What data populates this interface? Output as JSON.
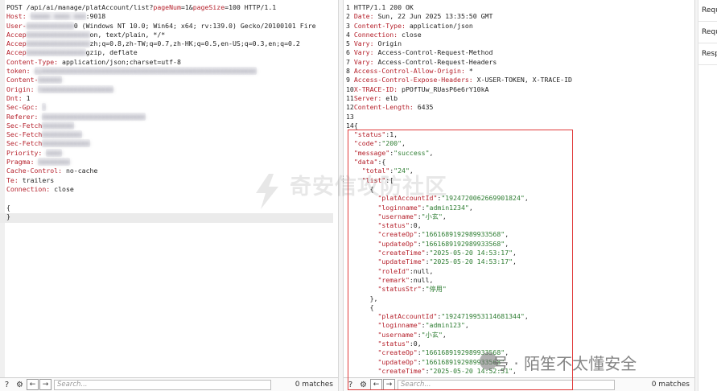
{
  "request": {
    "lines": [
      [
        {
          "t": "POST /api/ai/manage/platAccount/list?",
          "c": "v"
        },
        {
          "t": "pageNum",
          "c": "k"
        },
        {
          "t": "=1&",
          "c": "v"
        },
        {
          "t": "pageSize",
          "c": "k"
        },
        {
          "t": "=100 HTTP/1.1",
          "c": "v"
        }
      ],
      [
        {
          "t": "Host: ",
          "c": "k"
        },
        {
          "t": "hmmmm mmmm mmm",
          "c": "blur"
        },
        {
          "t": ":9018",
          "c": "v"
        }
      ],
      [
        {
          "t": "User-",
          "c": "k"
        },
        {
          "t": "mmmmmmmmmmmm",
          "c": "blur"
        },
        {
          "t": "0 (Windows NT 10.0; Win64; x64; rv:139.0) Gecko/20100101 Fire",
          "c": "v"
        }
      ],
      [
        {
          "t": "Accep",
          "c": "k"
        },
        {
          "t": "mmmmmmmmmmmmmmmm",
          "c": "blur"
        },
        {
          "t": "on, text/plain, */*",
          "c": "v"
        }
      ],
      [
        {
          "t": "Accep",
          "c": "k"
        },
        {
          "t": "mmmmmmmmmmmmmmmm",
          "c": "blur"
        },
        {
          "t": "zh;q=0.8,zh-TW;q=0.7,zh-HK;q=0.5,en-US;q=0.3,en;q=0.2",
          "c": "v"
        }
      ],
      [
        {
          "t": "Accep",
          "c": "k"
        },
        {
          "t": "mmmmmmmmmmmmmmm",
          "c": "blur"
        },
        {
          "t": "gzip, deflate",
          "c": "v"
        }
      ],
      [
        {
          "t": "Content-Type: ",
          "c": "k"
        },
        {
          "t": "application/json;charset=utf-8",
          "c": "v"
        }
      ],
      [
        {
          "t": "token: ",
          "c": "k"
        },
        {
          "t": "eymmmmmmmmmmmmmmmmmmmmmmmmmmmmmmmmmmmmmmmmmmmmmmmmmmmmmm",
          "c": "blur"
        }
      ],
      [
        {
          "t": "Content-",
          "c": "k"
        },
        {
          "t": "mmmmmm",
          "c": "blur"
        }
      ],
      [
        {
          "t": "Origin: ",
          "c": "k"
        },
        {
          "t": "hmmmmmmmmmmmmmmmmmm",
          "c": "blur"
        }
      ],
      [
        {
          "t": "Dnt: ",
          "c": "k"
        },
        {
          "t": "1",
          "c": "v"
        }
      ],
      [
        {
          "t": "Sec-Gpc: ",
          "c": "k"
        },
        {
          "t": "1",
          "c": "blur"
        }
      ],
      [
        {
          "t": "Referer: ",
          "c": "k"
        },
        {
          "t": "mmmmmmmmmmmmmmmmmmmmmmmmmm",
          "c": "blur"
        }
      ],
      [
        {
          "t": "Sec-Fetch",
          "c": "k"
        },
        {
          "t": "mmmmmmmm",
          "c": "blur"
        }
      ],
      [
        {
          "t": "Sec-Fetch",
          "c": "k"
        },
        {
          "t": "mmmmmmmmmm",
          "c": "blur"
        }
      ],
      [
        {
          "t": "Sec-Fetch",
          "c": "k"
        },
        {
          "t": "mmmmmmmmmmmm",
          "c": "blur"
        }
      ],
      [
        {
          "t": "Priority: ",
          "c": "k"
        },
        {
          "t": "mmmm",
          "c": "blur"
        }
      ],
      [
        {
          "t": "Pragma: ",
          "c": "k"
        },
        {
          "t": "mmmmmmmm",
          "c": "blur"
        }
      ],
      [
        {
          "t": "Cache-Control: ",
          "c": "k"
        },
        {
          "t": "no-cache",
          "c": "v"
        }
      ],
      [
        {
          "t": "Te: ",
          "c": "k"
        },
        {
          "t": "trailers",
          "c": "v"
        }
      ],
      [
        {
          "t": "Connection: ",
          "c": "k"
        },
        {
          "t": "close",
          "c": "v"
        }
      ],
      [
        {
          "t": "",
          "c": "v"
        }
      ],
      [
        {
          "t": "{",
          "c": "v"
        }
      ],
      [
        {
          "t": "}",
          "c": "v"
        }
      ]
    ],
    "search_placeholder": "Search...",
    "matches": "0 matches"
  },
  "response": {
    "lines": [
      [
        {
          "t": "1 ",
          "c": "v"
        },
        {
          "t": "HTTP/1.1 200 OK",
          "c": "v"
        }
      ],
      [
        {
          "t": "2 ",
          "c": "v"
        },
        {
          "t": "Date: ",
          "c": "k"
        },
        {
          "t": "Sun, 22 Jun 2025 13:35:50 GMT",
          "c": "v"
        }
      ],
      [
        {
          "t": "3 ",
          "c": "v"
        },
        {
          "t": "Content-Type: ",
          "c": "k"
        },
        {
          "t": "application/json",
          "c": "v"
        }
      ],
      [
        {
          "t": "4 ",
          "c": "v"
        },
        {
          "t": "Connection: ",
          "c": "k"
        },
        {
          "t": "close",
          "c": "v"
        }
      ],
      [
        {
          "t": "5 ",
          "c": "v"
        },
        {
          "t": "Vary: ",
          "c": "k"
        },
        {
          "t": "Origin",
          "c": "v"
        }
      ],
      [
        {
          "t": "6 ",
          "c": "v"
        },
        {
          "t": "Vary: ",
          "c": "k"
        },
        {
          "t": "Access-Control-Request-Method",
          "c": "v"
        }
      ],
      [
        {
          "t": "7 ",
          "c": "v"
        },
        {
          "t": "Vary: ",
          "c": "k"
        },
        {
          "t": "Access-Control-Request-Headers",
          "c": "v"
        }
      ],
      [
        {
          "t": "8 ",
          "c": "v"
        },
        {
          "t": "Access-Control-Allow-Origin: ",
          "c": "k"
        },
        {
          "t": "*",
          "c": "v"
        }
      ],
      [
        {
          "t": "9 ",
          "c": "v"
        },
        {
          "t": "Access-Control-Expose-Headers: ",
          "c": "k"
        },
        {
          "t": "X-USER-TOKEN, X-TRACE-ID",
          "c": "v"
        }
      ],
      [
        {
          "t": "10",
          "c": "v"
        },
        {
          "t": "X-TRACE-ID: ",
          "c": "k"
        },
        {
          "t": "pPOfTUw_RUasP6e6rY10kA",
          "c": "v"
        }
      ],
      [
        {
          "t": "11",
          "c": "v"
        },
        {
          "t": "Server: ",
          "c": "k"
        },
        {
          "t": "elb",
          "c": "v"
        }
      ],
      [
        {
          "t": "12",
          "c": "v"
        },
        {
          "t": "Content-Length: ",
          "c": "k"
        },
        {
          "t": "6435",
          "c": "v"
        }
      ],
      [
        {
          "t": "13",
          "c": "v"
        }
      ],
      [
        {
          "t": "14",
          "c": "v"
        },
        {
          "t": "{",
          "c": "v"
        }
      ],
      [
        {
          "t": "  ",
          "c": "v"
        },
        {
          "t": "\"status\"",
          "c": "k"
        },
        {
          "t": ":1,",
          "c": "n"
        }
      ],
      [
        {
          "t": "  ",
          "c": "v"
        },
        {
          "t": "\"code\"",
          "c": "k"
        },
        {
          "t": ":",
          "c": "n"
        },
        {
          "t": "\"200\"",
          "c": "s"
        },
        {
          "t": ",",
          "c": "n"
        }
      ],
      [
        {
          "t": "  ",
          "c": "v"
        },
        {
          "t": "\"message\"",
          "c": "k"
        },
        {
          "t": ":",
          "c": "n"
        },
        {
          "t": "\"success\"",
          "c": "s"
        },
        {
          "t": ",",
          "c": "n"
        }
      ],
      [
        {
          "t": "  ",
          "c": "v"
        },
        {
          "t": "\"data\"",
          "c": "k"
        },
        {
          "t": ":{",
          "c": "n"
        }
      ],
      [
        {
          "t": "    ",
          "c": "v"
        },
        {
          "t": "\"total\"",
          "c": "k"
        },
        {
          "t": ":",
          "c": "n"
        },
        {
          "t": "\"24\"",
          "c": "s"
        },
        {
          "t": ",",
          "c": "n"
        }
      ],
      [
        {
          "t": "    ",
          "c": "v"
        },
        {
          "t": "\"list\"",
          "c": "k"
        },
        {
          "t": ":[",
          "c": "n"
        }
      ],
      [
        {
          "t": "      ",
          "c": "v"
        },
        {
          "t": "{",
          "c": "n"
        }
      ],
      [
        {
          "t": "        ",
          "c": "v"
        },
        {
          "t": "\"platAccountId\"",
          "c": "k"
        },
        {
          "t": ":",
          "c": "n"
        },
        {
          "t": "\"1924720062669901824\"",
          "c": "s"
        },
        {
          "t": ",",
          "c": "n"
        }
      ],
      [
        {
          "t": "        ",
          "c": "v"
        },
        {
          "t": "\"loginname\"",
          "c": "k"
        },
        {
          "t": ":",
          "c": "n"
        },
        {
          "t": "\"admin1234\"",
          "c": "s"
        },
        {
          "t": ",",
          "c": "n"
        }
      ],
      [
        {
          "t": "        ",
          "c": "v"
        },
        {
          "t": "\"username\"",
          "c": "k"
        },
        {
          "t": ":",
          "c": "n"
        },
        {
          "t": "\"小玄\"",
          "c": "s"
        },
        {
          "t": ",",
          "c": "n"
        }
      ],
      [
        {
          "t": "        ",
          "c": "v"
        },
        {
          "t": "\"status\"",
          "c": "k"
        },
        {
          "t": ":0,",
          "c": "n"
        }
      ],
      [
        {
          "t": "        ",
          "c": "v"
        },
        {
          "t": "\"createOp\"",
          "c": "k"
        },
        {
          "t": ":",
          "c": "n"
        },
        {
          "t": "\"1661689192989933568\"",
          "c": "s"
        },
        {
          "t": ",",
          "c": "n"
        }
      ],
      [
        {
          "t": "        ",
          "c": "v"
        },
        {
          "t": "\"updateOp\"",
          "c": "k"
        },
        {
          "t": ":",
          "c": "n"
        },
        {
          "t": "\"1661689192989933568\"",
          "c": "s"
        },
        {
          "t": ",",
          "c": "n"
        }
      ],
      [
        {
          "t": "        ",
          "c": "v"
        },
        {
          "t": "\"createTime\"",
          "c": "k"
        },
        {
          "t": ":",
          "c": "n"
        },
        {
          "t": "\"2025-05-20 14:53:17\"",
          "c": "s"
        },
        {
          "t": ",",
          "c": "n"
        }
      ],
      [
        {
          "t": "        ",
          "c": "v"
        },
        {
          "t": "\"updateTime\"",
          "c": "k"
        },
        {
          "t": ":",
          "c": "n"
        },
        {
          "t": "\"2025-05-20 14:53:17\"",
          "c": "s"
        },
        {
          "t": ",",
          "c": "n"
        }
      ],
      [
        {
          "t": "        ",
          "c": "v"
        },
        {
          "t": "\"roleId\"",
          "c": "k"
        },
        {
          "t": ":null,",
          "c": "n"
        }
      ],
      [
        {
          "t": "        ",
          "c": "v"
        },
        {
          "t": "\"remark\"",
          "c": "k"
        },
        {
          "t": ":null,",
          "c": "n"
        }
      ],
      [
        {
          "t": "        ",
          "c": "v"
        },
        {
          "t": "\"statusStr\"",
          "c": "k"
        },
        {
          "t": ":",
          "c": "n"
        },
        {
          "t": "\"停用\"",
          "c": "s"
        }
      ],
      [
        {
          "t": "      ",
          "c": "v"
        },
        {
          "t": "},",
          "c": "n"
        }
      ],
      [
        {
          "t": "      ",
          "c": "v"
        },
        {
          "t": "{",
          "c": "n"
        }
      ],
      [
        {
          "t": "        ",
          "c": "v"
        },
        {
          "t": "\"platAccountId\"",
          "c": "k"
        },
        {
          "t": ":",
          "c": "n"
        },
        {
          "t": "\"1924719953114681344\"",
          "c": "s"
        },
        {
          "t": ",",
          "c": "n"
        }
      ],
      [
        {
          "t": "        ",
          "c": "v"
        },
        {
          "t": "\"loginname\"",
          "c": "k"
        },
        {
          "t": ":",
          "c": "n"
        },
        {
          "t": "\"admin123\"",
          "c": "s"
        },
        {
          "t": ",",
          "c": "n"
        }
      ],
      [
        {
          "t": "        ",
          "c": "v"
        },
        {
          "t": "\"username\"",
          "c": "k"
        },
        {
          "t": ":",
          "c": "n"
        },
        {
          "t": "\"小玄\"",
          "c": "s"
        },
        {
          "t": ",",
          "c": "n"
        }
      ],
      [
        {
          "t": "        ",
          "c": "v"
        },
        {
          "t": "\"status\"",
          "c": "k"
        },
        {
          "t": ":0,",
          "c": "n"
        }
      ],
      [
        {
          "t": "        ",
          "c": "v"
        },
        {
          "t": "\"createOp\"",
          "c": "k"
        },
        {
          "t": ":",
          "c": "n"
        },
        {
          "t": "\"1661689192989933568\"",
          "c": "s"
        },
        {
          "t": ",",
          "c": "n"
        }
      ],
      [
        {
          "t": "        ",
          "c": "v"
        },
        {
          "t": "\"updateOp\"",
          "c": "k"
        },
        {
          "t": ":",
          "c": "n"
        },
        {
          "t": "\"1661689192989933568\"",
          "c": "s"
        },
        {
          "t": ",",
          "c": "n"
        }
      ],
      [
        {
          "t": "        ",
          "c": "v"
        },
        {
          "t": "\"createTime\"",
          "c": "k"
        },
        {
          "t": ":",
          "c": "n"
        },
        {
          "t": "\"2025-05-20 14:52:51\"",
          "c": "s"
        },
        {
          "t": ",",
          "c": "n"
        }
      ]
    ],
    "search_placeholder": "Search...",
    "matches": "0 matches"
  },
  "side_tabs": [
    "Requ",
    "Requ",
    "Resp"
  ],
  "watermark": "奇安信攻防社区",
  "credit": "号 · 陌笙不太懂安全",
  "colors": {
    "key": "#b5202b",
    "string": "#2e7d32",
    "highlight": "#e03a3a"
  }
}
